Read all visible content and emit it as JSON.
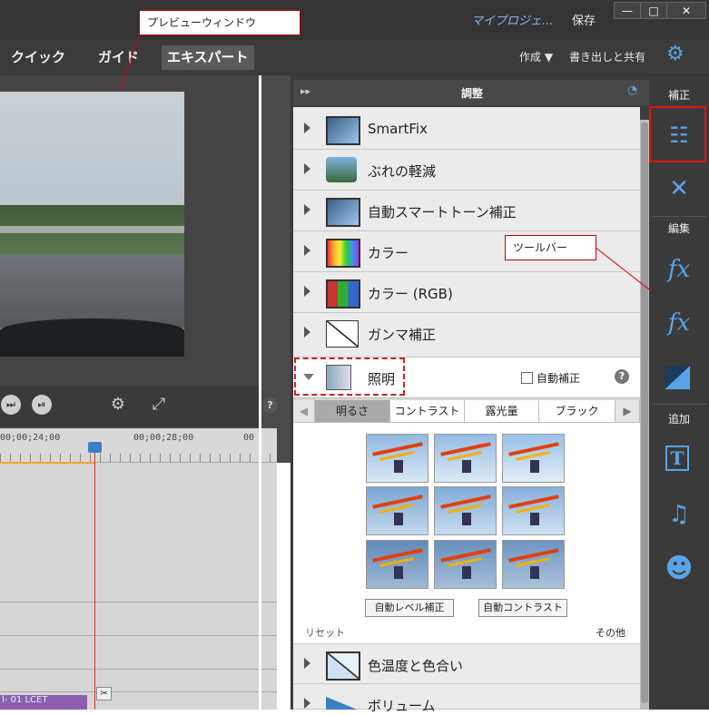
{
  "window": {
    "project_name": "マイプロジェ...",
    "save_label": "保存",
    "min_label": "—",
    "max_label": "□",
    "close_label": "✕"
  },
  "modes": {
    "quick": "クイック",
    "guide": "ガイド",
    "expert": "エキスパート"
  },
  "header_actions": {
    "create": "作成 ▼",
    "export": "書き出しと共有"
  },
  "timeline": {
    "timecodes": [
      "00;00;24;00",
      "00;00;28;00",
      "00"
    ],
    "clip_label": "l- 01 LCET"
  },
  "panel": {
    "title": "調整",
    "items": [
      {
        "label": "SmartFix",
        "icon": "smartfix-icon"
      },
      {
        "label": "ぶれの軽減",
        "icon": "shake-reduction-icon"
      },
      {
        "label": "自動スマートトーン補正",
        "icon": "smart-tone-icon"
      },
      {
        "label": "カラー",
        "icon": "color-icon"
      },
      {
        "label": "カラー (RGB)",
        "icon": "color-rgb-icon"
      },
      {
        "label": "ガンマ補正",
        "icon": "gamma-icon"
      }
    ],
    "lighting": {
      "label": "照明",
      "auto_fix_label": "自動補正",
      "tabs": [
        "明るさ",
        "コントラスト",
        "露光量",
        "ブラック"
      ],
      "auto_levels_button": "自動レベル補正",
      "auto_contrast_button": "自動コントラスト",
      "reset_label": "リセット",
      "other_label": "その他"
    },
    "items_after": [
      {
        "label": "色温度と色合い",
        "icon": "temperature-icon"
      },
      {
        "label": "ボリューム",
        "icon": "volume-icon"
      }
    ]
  },
  "toolbar": {
    "section_fix": "補正",
    "section_edit": "編集",
    "section_add": "追加"
  },
  "callouts": {
    "preview": "プレビューウィンドウ",
    "toolbar": "ツールバー"
  },
  "colors": {
    "accent_blue": "#5aa3e6",
    "callout_red": "#d00000",
    "playhead": "#e03030"
  }
}
